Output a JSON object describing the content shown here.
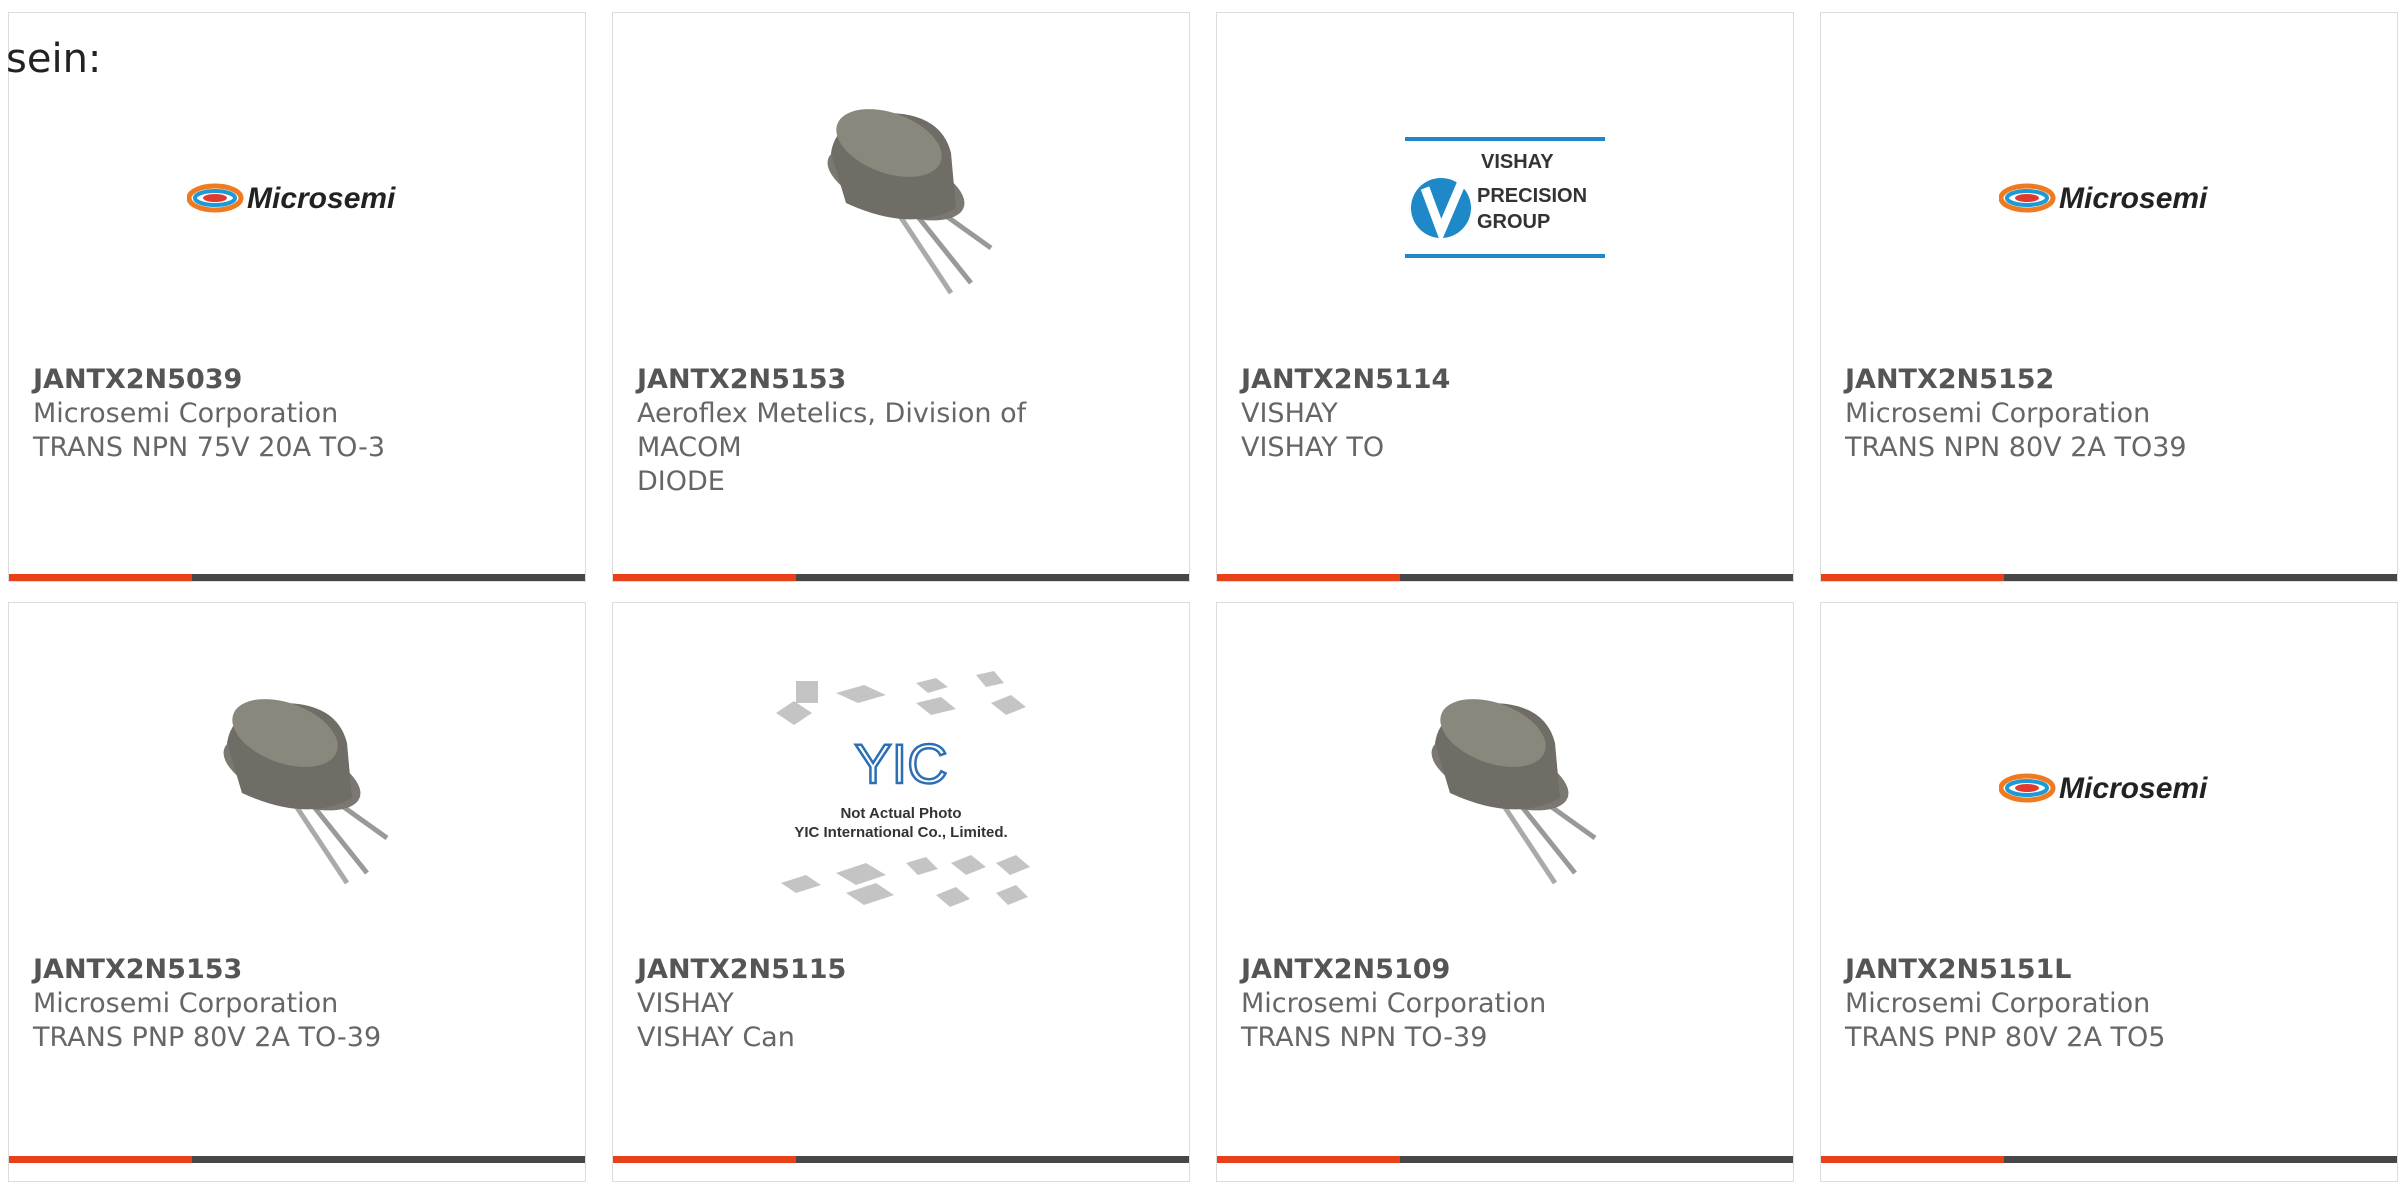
{
  "intro_text": "sein:",
  "cards": [
    {
      "part": "JANTX2N5039",
      "manufacturer": "Microsemi Corporation",
      "desc": "TRANS NPN 75V 20A TO-3",
      "image": "microsemi-logo"
    },
    {
      "part": "JANTX2N5153",
      "manufacturer": "Aeroflex Metelics, Division of MACOM",
      "desc": "DIODE",
      "image": "to39-transistor-photo"
    },
    {
      "part": "JANTX2N5114",
      "manufacturer": "VISHAY",
      "desc": "VISHAY TO",
      "image": "vishay-precision-logo"
    },
    {
      "part": "JANTX2N5152",
      "manufacturer": "Microsemi Corporation",
      "desc": "TRANS NPN 80V 2A TO39",
      "image": "microsemi-logo"
    },
    {
      "part": "JANTX2N5153",
      "manufacturer": "Microsemi Corporation",
      "desc": "TRANS PNP 80V 2A TO-39",
      "image": "to39-transistor-photo"
    },
    {
      "part": "JANTX2N5115",
      "manufacturer": "VISHAY",
      "desc": "VISHAY Can",
      "image": "yic-placeholder"
    },
    {
      "part": "JANTX2N5109",
      "manufacturer": "Microsemi Corporation",
      "desc": "TRANS NPN TO-39",
      "image": "to39-transistor-photo"
    },
    {
      "part": "JANTX2N5151L",
      "manufacturer": "Microsemi Corporation",
      "desc": "TRANS PNP 80V 2A TO5",
      "image": "microsemi-logo"
    }
  ],
  "logos": {
    "microsemi": "Microsemi",
    "vishay_line1": "VISHAY",
    "vishay_line2": "PRECISION",
    "vishay_line3": "GROUP",
    "yic_mark": "YIC",
    "yic_line1": "Not Actual Photo",
    "yic_line2": "YIC International Co., Limited."
  },
  "colors": {
    "accent": "#e8411a",
    "bar": "#474747",
    "text": "#666666",
    "vishay_blue": "#1e88c8",
    "microsemi_orange": "#f07a1f"
  }
}
